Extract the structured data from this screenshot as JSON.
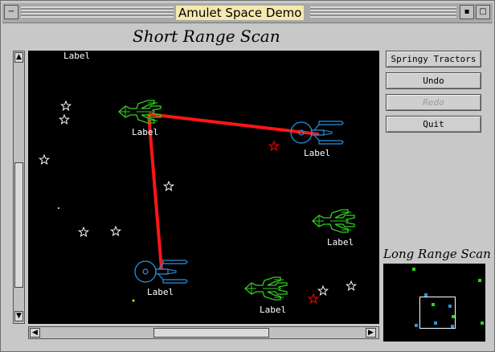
{
  "window": {
    "title": "Amulet Space Demo"
  },
  "short_range": {
    "title": "Short Range Scan"
  },
  "long_range": {
    "title": "Long Range Scan"
  },
  "buttons": [
    {
      "label": "Springy Tractors",
      "enabled": true
    },
    {
      "label": "Undo",
      "enabled": true
    },
    {
      "label": "Redo",
      "enabled": false
    },
    {
      "label": "Quit",
      "enabled": true
    }
  ],
  "ships": [
    {
      "label": "Label",
      "faction": "green"
    },
    {
      "label": "Label",
      "faction": "blue"
    },
    {
      "label": "Label",
      "faction": "blue"
    },
    {
      "label": "Label",
      "faction": "green"
    },
    {
      "label": "Label",
      "faction": "green"
    }
  ],
  "floating_label": "Label",
  "colors": {
    "space": "#000000",
    "green_ship": "#30d020",
    "blue_ship": "#2a90e0",
    "tractor_beam": "#ff1515",
    "star": "#ffffff",
    "red_star": "#e00000",
    "title_highlight": "#f5e8b0"
  },
  "icons": [
    "close-icon",
    "minimize-icon",
    "maximize-icon",
    "scroll-up-icon",
    "scroll-down-icon",
    "scroll-left-icon",
    "scroll-right-icon",
    "star-icon"
  ]
}
